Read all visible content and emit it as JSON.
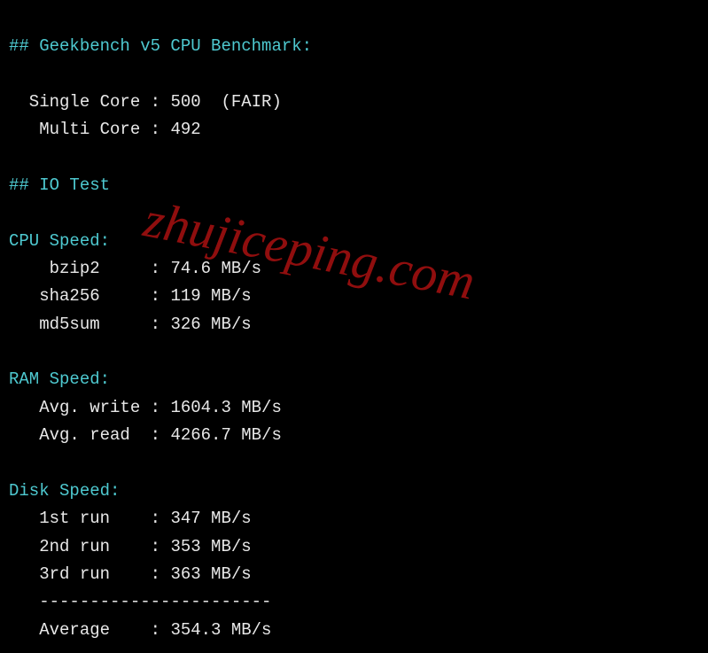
{
  "watermark": "zhujiceping.com",
  "geekbench": {
    "header": "## Geekbench v5 CPU Benchmark:",
    "single_core_label": "  Single Core : ",
    "single_core_value": "500  (FAIR)",
    "multi_core_label": "   Multi Core : ",
    "multi_core_value": "492"
  },
  "io_test": {
    "header": "## IO Test"
  },
  "cpu_speed": {
    "header": "CPU Speed:",
    "bzip2_label": "    bzip2     : ",
    "bzip2_value": "74.6 MB/s",
    "sha256_label": "   sha256     : ",
    "sha256_value": "119 MB/s",
    "md5sum_label": "   md5sum     : ",
    "md5sum_value": "326 MB/s"
  },
  "ram_speed": {
    "header": "RAM Speed:",
    "write_label": "   Avg. write : ",
    "write_value": "1604.3 MB/s",
    "read_label": "   Avg. read  : ",
    "read_value": "4266.7 MB/s"
  },
  "disk_speed": {
    "header": "Disk Speed:",
    "run1_label": "   1st run    : ",
    "run1_value": "347 MB/s",
    "run2_label": "   2nd run    : ",
    "run2_value": "353 MB/s",
    "run3_label": "   3rd run    : ",
    "run3_value": "363 MB/s",
    "divider": "   -----------------------",
    "avg_label": "   Average    : ",
    "avg_value": "354.3 MB/s"
  }
}
